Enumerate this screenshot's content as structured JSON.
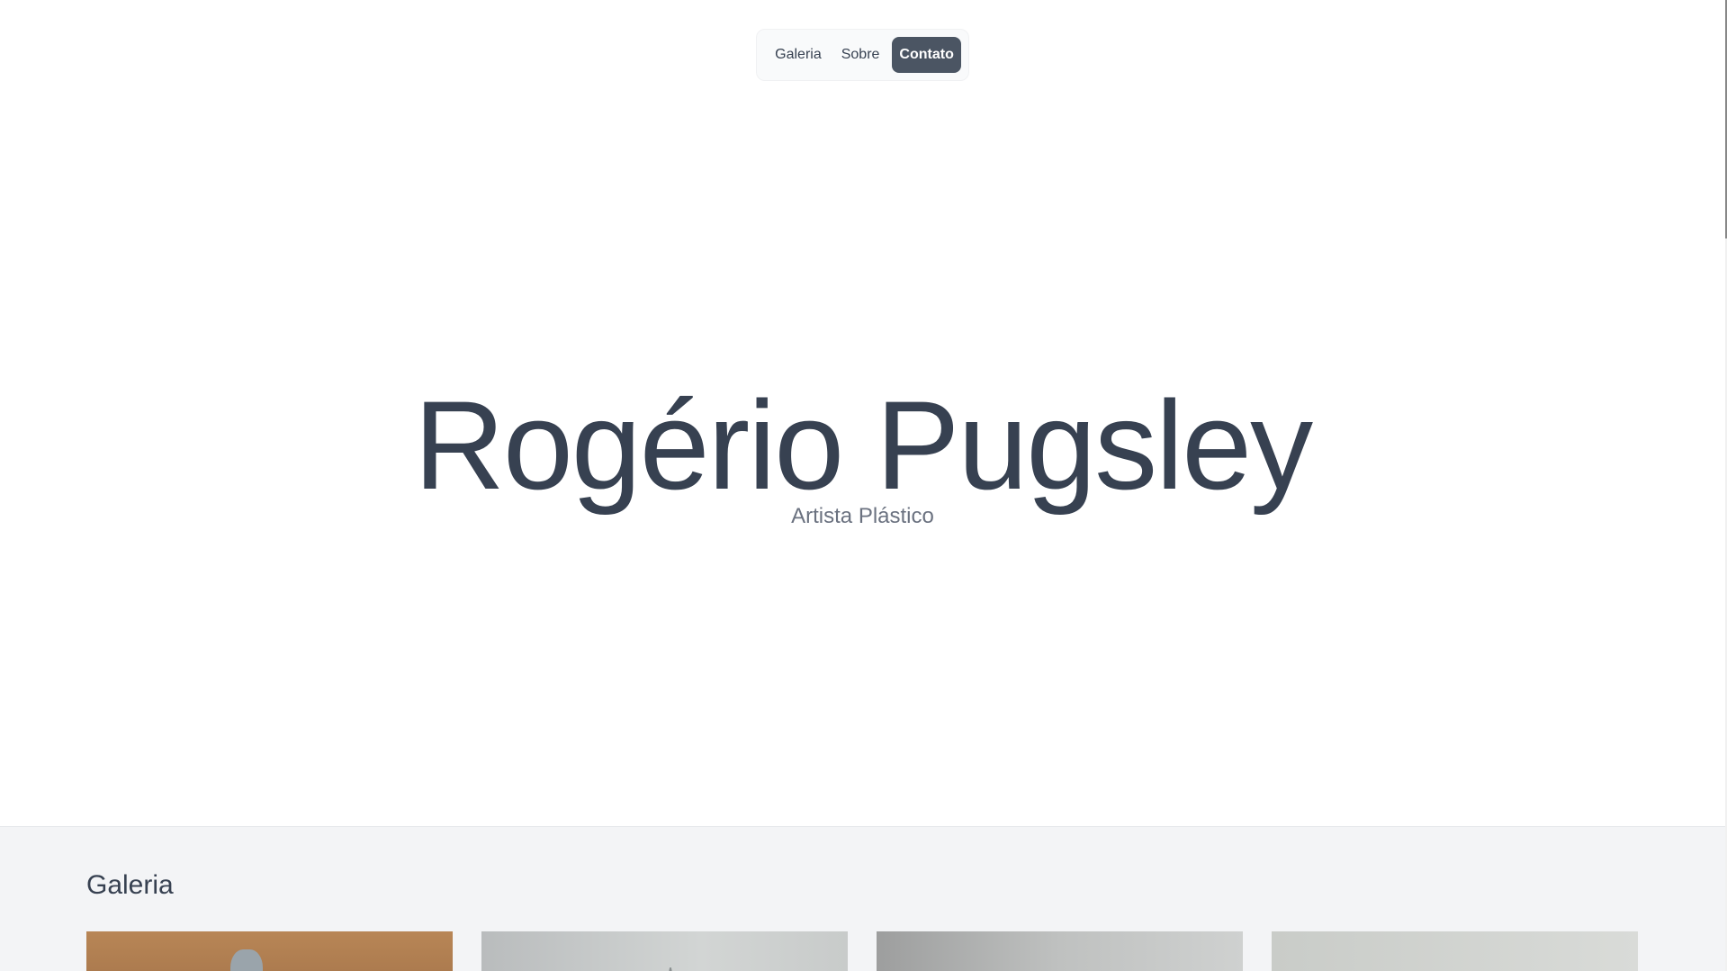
{
  "nav": {
    "items": [
      {
        "label": "Galeria",
        "active": false
      },
      {
        "label": "Sobre",
        "active": false
      },
      {
        "label": "Contato",
        "active": true
      }
    ]
  },
  "hero": {
    "title": "Rogério Pugsley",
    "subtitle": "Artista Plástico"
  },
  "gallery": {
    "heading": "Galeria"
  },
  "colors": {
    "text": "#374151",
    "muted": "#6b7280",
    "active_nav_bg": "#4b5563",
    "gallery_bg": "#f3f4f6"
  }
}
